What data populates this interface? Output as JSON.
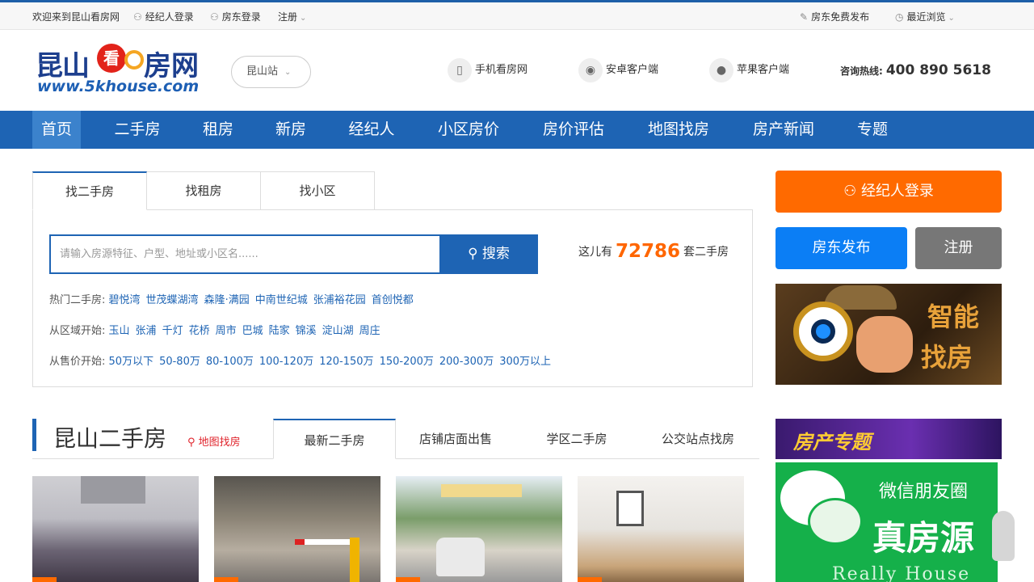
{
  "topbar": {
    "welcome": "欢迎来到昆山看房网",
    "agent_login": "经纪人登录",
    "owner_login": "房东登录",
    "register": "注册",
    "owner_publish": "房东免费发布",
    "recent": "最近浏览"
  },
  "header": {
    "logo_cn_1": "昆山",
    "logo_kan": "看",
    "logo_cn_2": "房网",
    "logo_url": "www.5khouse.com",
    "station": "昆山站",
    "mobile": "手机看房网",
    "android": "安卓客户端",
    "ios": "苹果客户端",
    "hotline_label": "咨询热线:",
    "hotline_number": "400 890 5618"
  },
  "nav": {
    "items": [
      "首页",
      "二手房",
      "租房",
      "新房",
      "经纪人",
      "小区房价",
      "房价评估",
      "地图找房",
      "房产新闻",
      "专题"
    ]
  },
  "search": {
    "tabs": [
      "找二手房",
      "找租房",
      "找小区"
    ],
    "placeholder": "请输入房源特征、户型、地址或小区名......",
    "button": "搜索",
    "count_prefix": "这儿有",
    "count": "72786",
    "count_suffix": "套二手房",
    "hot_label": "热门二手房:",
    "hot_items": [
      "碧悦湾",
      "世茂蝶湖湾",
      "森隆·满园",
      "中南世纪城",
      "张浦裕花园",
      "首创悦都"
    ],
    "area_label": "从区域开始:",
    "area_items": [
      "玉山",
      "张浦",
      "千灯",
      "花桥",
      "周市",
      "巴城",
      "陆家",
      "锦溪",
      "淀山湖",
      "周庄"
    ],
    "price_label": "从售价开始:",
    "price_items": [
      "50万以下",
      "50-80万",
      "80-100万",
      "100-120万",
      "120-150万",
      "150-200万",
      "200-300万",
      "300万以上"
    ]
  },
  "sidebar": {
    "agent_login": "经纪人登录",
    "owner_publish": "房东发布",
    "register": "注册",
    "smart_1": "智能",
    "smart_2": "找房",
    "topic": "房产专题",
    "wx_1": "微信朋友圈",
    "wx_2": "真房源",
    "wx_3": "Really House"
  },
  "section": {
    "title": "昆山二手房",
    "map_link": "地图找房",
    "tabs": [
      "最新二手房",
      "店铺店面出售",
      "学区二手房",
      "公交站点找房"
    ]
  },
  "colors": {
    "brand_blue": "#1e64b4",
    "accent_orange": "#ff6a00",
    "owner_blue": "#0b7ef5",
    "gray_button": "#777777",
    "link_blue": "#1e64b4"
  },
  "icons": {
    "agent": "person-icon",
    "owner": "person-icon",
    "publish": "edit-icon",
    "recent": "clock-icon",
    "mobile": "phone-icon",
    "android": "android-icon",
    "ios": "apple-icon",
    "search": "search-icon",
    "map": "map-pin-icon"
  }
}
